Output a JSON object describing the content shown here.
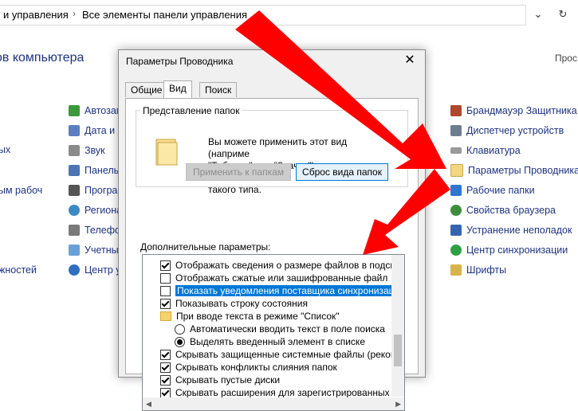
{
  "address": {
    "crumb1": "и управления",
    "crumb2": "Все элементы панели управления",
    "dropdown": "⌄",
    "refresh": "↻"
  },
  "panel": {
    "title": "ов компьютера",
    "view_link": "Прос",
    "left_cut": [
      "ых",
      "ым рабоч",
      "жностей"
    ],
    "mid_items": [
      "Автозапу",
      "Дата и вр",
      "Звук",
      "Панель з",
      "Програм",
      "Регионал",
      "Телефон",
      "Учетные",
      "Центр упр"
    ],
    "right_items": [
      "Брандмауэр Защитника W",
      "Диспетчер устройств",
      "Клавиатура",
      "Параметры Проводника",
      "Рабочие папки",
      "Свойства браузера",
      "Устранение неполадок",
      "Центр синхронизации",
      "Шрифты"
    ]
  },
  "dialog": {
    "title": "Параметры Проводника",
    "close": "✕",
    "tabs": [
      "Общие",
      "Вид",
      "Поиск"
    ],
    "group_label": "Представление папок",
    "group_desc": "Вы можете применить этот вид (наприме\n\"Таблица\" или \"Значки\") ко всем папкам\nтакого типа.",
    "apply_button": "Применить к папкам",
    "reset_button": "Сброс вида папок",
    "advanced_label": "Дополнительные параметры:",
    "rows": [
      "Отображать сведения о размере файлов в подск",
      "Отображать сжатые или зашифрованные файл",
      "Показать уведомления поставщика синхронизации",
      "Показывать строку состояния",
      "При вводе текста в режиме \"Список\"",
      "Автоматически вводить текст в поле поиска",
      "Выделять введенный элемент в списке",
      "Скрывать защищенные системные файлы (рекомен",
      "Скрывать конфликты слияния папок",
      "Скрывать пустые диски",
      "Скрывать расширения для зарегистрированных типо"
    ]
  },
  "colors": {
    "link": "#1e3287",
    "selection": "#0078d7",
    "arrow": "#ff0000"
  }
}
